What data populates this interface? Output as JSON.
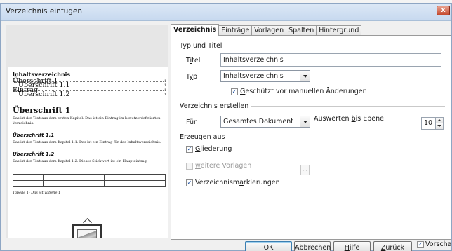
{
  "dialog": {
    "title": "Verzeichnis einfügen",
    "close_label": "x"
  },
  "preview": {
    "toc_title": "Inhaltsverzeichnis",
    "toc_entries": [
      {
        "label": "Überschrift 1",
        "page": "1"
      },
      {
        "label": "Überschrift 1.1",
        "page": "1"
      },
      {
        "label": "Eintrag",
        "page": "1"
      },
      {
        "label": "Überschrift 1.2",
        "page": "1"
      }
    ],
    "heading1": "Überschrift 1",
    "heading1_text": "Das ist der Text aus dem ersten Kapitel. Das ist ein Eintrag im benutzerdefinierten Verzeichnis.",
    "heading11": "Überschrift 1.1",
    "heading11_text": "Das ist der Text aus dem Kapitel 1.1. Das ist ein Eintrag für das Inhaltsverzeichnis.",
    "heading12": "Überschrift 1.2",
    "heading12_text": "Das ist der Text aus dem Kapitel 1.2. Dieses Stichwort ist ein Haupteintrag.",
    "table_caption": "Tabelle 1: Das ist Tabelle 1"
  },
  "tabs": [
    "Verzeichnis",
    "Einträge",
    "Vorlagen",
    "Spalten",
    "Hintergrund"
  ],
  "active_tab": "Verzeichnis",
  "type_title": {
    "group": "Typ und Titel",
    "title_label_pre": "T",
    "title_label_u": "i",
    "title_label_post": "tel",
    "title_value": "Inhaltsverzeichnis",
    "type_label_pre": "T",
    "type_label_u": "y",
    "type_label_post": "p",
    "type_value": "Inhaltsverzeichnis",
    "protected_pre": "",
    "protected_u": "G",
    "protected_post": "eschützt vor manuellen Änderungen",
    "protected_checked": true
  },
  "create": {
    "group_u": "V",
    "group_post": "erzeichnis erstellen",
    "for_label": "Für",
    "for_value": "Gesamtes Dokument",
    "evaluate_pre": "Auswerten ",
    "evaluate_u": "b",
    "evaluate_post": "is Ebene",
    "level_value": "10"
  },
  "create_from": {
    "group": "Erzeugen aus",
    "outline_u": "G",
    "outline_post": "liederung",
    "outline_checked": true,
    "more_styles_u": "w",
    "more_styles_post": "eitere Vorlagen",
    "more_styles_checked": false,
    "more_styles_btn": "...",
    "index_marks_pre": "Verzeichnism",
    "index_marks_u": "a",
    "index_marks_post": "rkierungen",
    "index_marks_checked": true
  },
  "buttons": {
    "ok": "OK",
    "cancel": "Abbrechen",
    "help_u": "H",
    "help_post": "ilfe",
    "back_u": "Z",
    "back_post": "urück",
    "preview_u": "V",
    "preview_post": "orschau",
    "preview_checked": true
  },
  "colors": {
    "accent": "#3c7fb1",
    "titlebar": "#c7d9ef",
    "close": "#c54a2f"
  }
}
